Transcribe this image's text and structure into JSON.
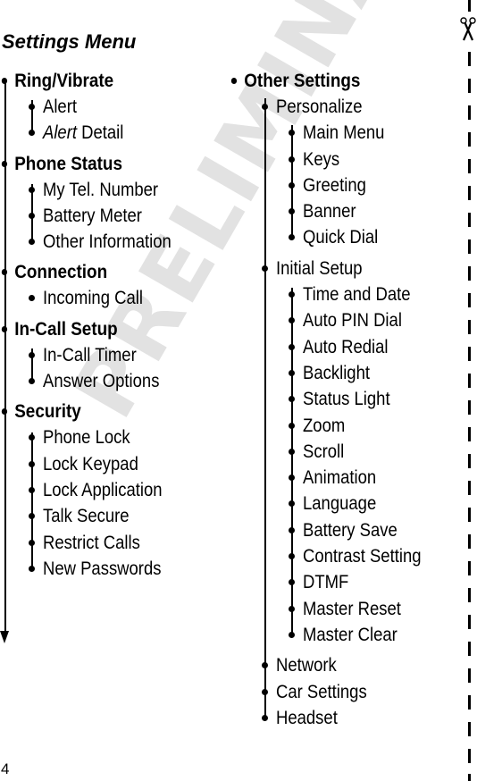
{
  "watermark": "PRELIMINARY",
  "title": "Settings Menu",
  "page_number": "4",
  "icons": {
    "scissors": "scissors-icon",
    "arrow": "arrow-down-icon"
  },
  "left_column": [
    {
      "label": "Ring/Vibrate",
      "children": [
        {
          "label_italic": "Alert",
          "label": ""
        },
        {
          "label_italic": "Alert",
          "label": " Detail"
        }
      ]
    },
    {
      "label": "Phone Status",
      "children": [
        {
          "label": "My Tel. Number"
        },
        {
          "label": "Battery Meter"
        },
        {
          "label": "Other Information"
        }
      ]
    },
    {
      "label": "Connection",
      "children": [
        {
          "label": "Incoming Call"
        }
      ]
    },
    {
      "label": "In-Call Setup",
      "children": [
        {
          "label": "In-Call Timer"
        },
        {
          "label": "Answer Options"
        }
      ]
    },
    {
      "label": "Security",
      "children": [
        {
          "label": "Phone Lock"
        },
        {
          "label": "Lock Keypad"
        },
        {
          "label": "Lock Application"
        },
        {
          "label": "Talk Secure"
        },
        {
          "label": "Restrict Calls"
        },
        {
          "label": "New Passwords"
        }
      ]
    }
  ],
  "right_column": {
    "label": "Other Settings",
    "children": [
      {
        "label": "Personalize",
        "children": [
          "Main Menu",
          "Keys",
          "Greeting",
          "Banner",
          "Quick Dial"
        ]
      },
      {
        "label": "Initial Setup",
        "children": [
          "Time and Date",
          "Auto PIN Dial",
          "Auto Redial",
          "Backlight",
          "Status Light",
          "Zoom",
          "Scroll",
          "Animation",
          "Language",
          "Battery Save",
          "Contrast Setting",
          "DTMF",
          "Master Reset",
          "Master Clear"
        ]
      },
      {
        "label": "Network",
        "children": []
      },
      {
        "label": "Car Settings",
        "children": []
      },
      {
        "label": "Headset",
        "children": []
      }
    ]
  }
}
